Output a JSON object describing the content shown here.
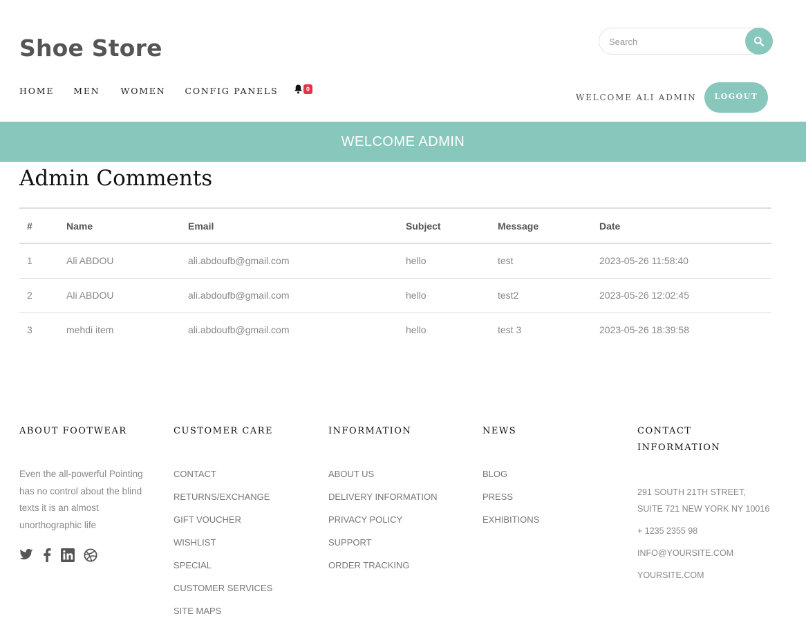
{
  "header": {
    "logo": "Shoe Store",
    "search_placeholder": "Search",
    "nav": [
      "HOME",
      "MEN",
      "WOMEN",
      "CONFIG PANELS"
    ],
    "notification_count": "0",
    "welcome_user": "WELCOME ALI ADMIN",
    "logout_label": "LOGOUT"
  },
  "banner": {
    "text": "WELCOME ADMIN"
  },
  "main": {
    "title": "Admin Comments",
    "columns": [
      "#",
      "Name",
      "Email",
      "Subject",
      "Message",
      "Date"
    ],
    "rows": [
      [
        "1",
        "Ali ABDOU",
        "ali.abdoufb@gmail.com",
        "hello",
        "test",
        "2023-05-26 11:58:40"
      ],
      [
        "2",
        "Ali ABDOU",
        "ali.abdoufb@gmail.com",
        "hello",
        "test2",
        "2023-05-26 12:02:45"
      ],
      [
        "3",
        "mehdi item",
        "ali.abdoufb@gmail.com",
        "hello",
        "test 3",
        "2023-05-26 18:39:58"
      ]
    ]
  },
  "footer": {
    "about": {
      "heading": "ABOUT FOOTWEAR",
      "text": "Even the all-powerful Pointing has no control about the blind texts it is an almost unorthographic life",
      "social_icons": [
        "twitter-icon",
        "facebook-icon",
        "linkedin-icon",
        "dribbble-icon"
      ]
    },
    "customer_care": {
      "heading": "CUSTOMER CARE",
      "links": [
        "CONTACT",
        "RETURNS/EXCHANGE",
        "GIFT VOUCHER",
        "WISHLIST",
        "SPECIAL",
        "CUSTOMER SERVICES",
        "SITE MAPS"
      ]
    },
    "information": {
      "heading": "INFORMATION",
      "links": [
        "ABOUT US",
        "DELIVERY INFORMATION",
        "PRIVACY POLICY",
        "SUPPORT",
        "ORDER TRACKING"
      ]
    },
    "news": {
      "heading": "NEWS",
      "links": [
        "BLOG",
        "PRESS",
        "EXHIBITIONS"
      ]
    },
    "contact": {
      "heading_line1": "CONTACT",
      "heading_line2": "INFORMATION",
      "address_line1": "291 SOUTH 21TH STREET,",
      "address_line2": "SUITE 721 NEW YORK NY 10016",
      "phone": "+ 1235 2355 98",
      "email": "INFO@YOURSITE.COM",
      "website": "YOURSITE.COM"
    }
  },
  "colors": {
    "accent": "#88c7bb",
    "badge": "#e03448"
  }
}
